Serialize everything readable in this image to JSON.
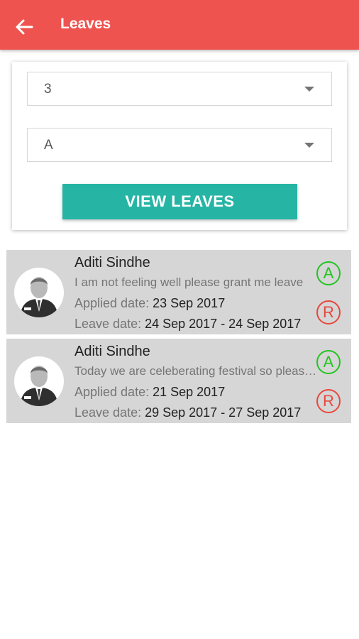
{
  "app_bar": {
    "title": "Leaves",
    "back_icon": "arrow-left-icon",
    "color": "#ef5350"
  },
  "filters": {
    "class_select": {
      "value": "3"
    },
    "section_select": {
      "value": "A"
    },
    "view_button_label": "VIEW LEAVES",
    "accent_color": "#26b5a5"
  },
  "leaves": [
    {
      "name": "Aditi Sindhe",
      "reason": "I am not feeling well please grant me leave",
      "applied_label": "Applied date:",
      "applied_date": "23 Sep 2017",
      "leave_label": "Leave date:",
      "leave_range": "24 Sep 2017 - 24 Sep 2017",
      "approve_label": "A",
      "reject_label": "R"
    },
    {
      "name": "Aditi Sindhe",
      "reason": "Today we are celeberating festival so please grant me leave",
      "applied_label": "Applied date:",
      "applied_date": "21 Sep 2017",
      "leave_label": "Leave date:",
      "leave_range": "29 Sep 2017 - 27 Sep 2017",
      "approve_label": "A",
      "reject_label": "R"
    }
  ],
  "colors": {
    "approve": "#22c51f",
    "reject": "#e8473d",
    "card_background": "#d6d6d6"
  }
}
